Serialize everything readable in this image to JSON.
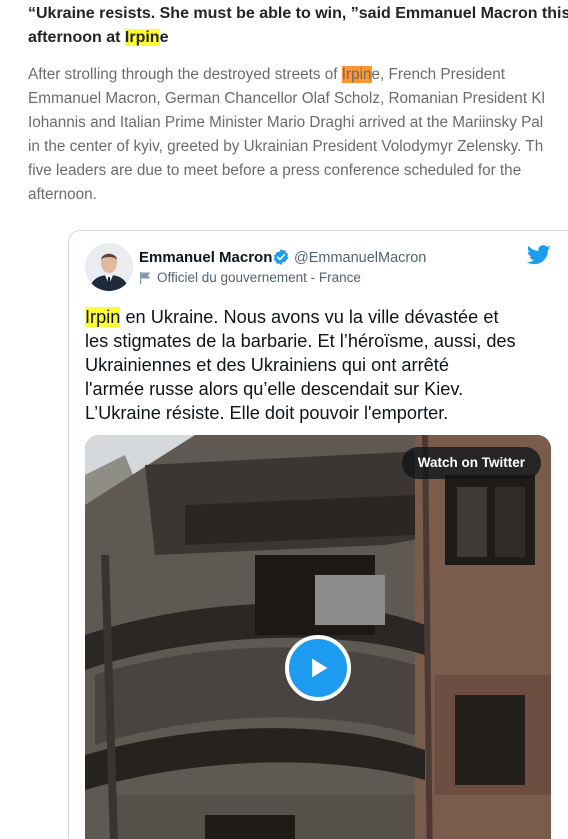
{
  "article": {
    "heading": {
      "line1": "“Ukraine resists. She must be able to win, ”said Emmanuel Macron this",
      "line2_before": "afternoon at ",
      "line2_highlight": "Irpin",
      "line2_after": "e"
    },
    "body": {
      "line1_before": "After strolling through the destroyed streets of ",
      "line1_highlight": "Irpin",
      "line1_after": "e, French President",
      "line2": "Emmanuel Macron, German Chancellor Olaf Scholz, Romanian President Kl",
      "line3": "Iohannis and Italian Prime Minister Mario Draghi arrived at the Mariinsky Pal",
      "line4": "in the center of kyiv, greeted by Ukrainian President Volodymyr Zelensky. Th",
      "line5": "five leaders are due to meet before a press conference scheduled for the",
      "line6": "afternoon."
    }
  },
  "tweet": {
    "author_name": "Emmanuel Macron",
    "handle": "@EmmanuelMacron",
    "government_label": "Officiel du gouvernement - France",
    "text": {
      "line1_highlight": "Irpin",
      "line1_after": " en Ukraine. Nous avons vu la ville dévastée et",
      "line2": "les stigmates de la barbarie. Et l’héroïsme, aussi, des",
      "line3": "Ukrainiennes et des Ukrainiens qui ont arrêté",
      "line4": "l'armée russe alors qu’elle descendait sur Kiev.",
      "line5": "L’Ukraine résiste. Elle doit pouvoir l'emporter."
    },
    "watch_label": "Watch on Twitter",
    "icons": {
      "verified": "verified-badge-icon",
      "twitter": "twitter-bird-icon",
      "government": "government-flag-icon",
      "play": "play-icon"
    },
    "colors": {
      "twitter_blue": "#1d9bf0",
      "highlight_yellow": "#ffff33",
      "highlight_orange": "#ff9632"
    }
  }
}
